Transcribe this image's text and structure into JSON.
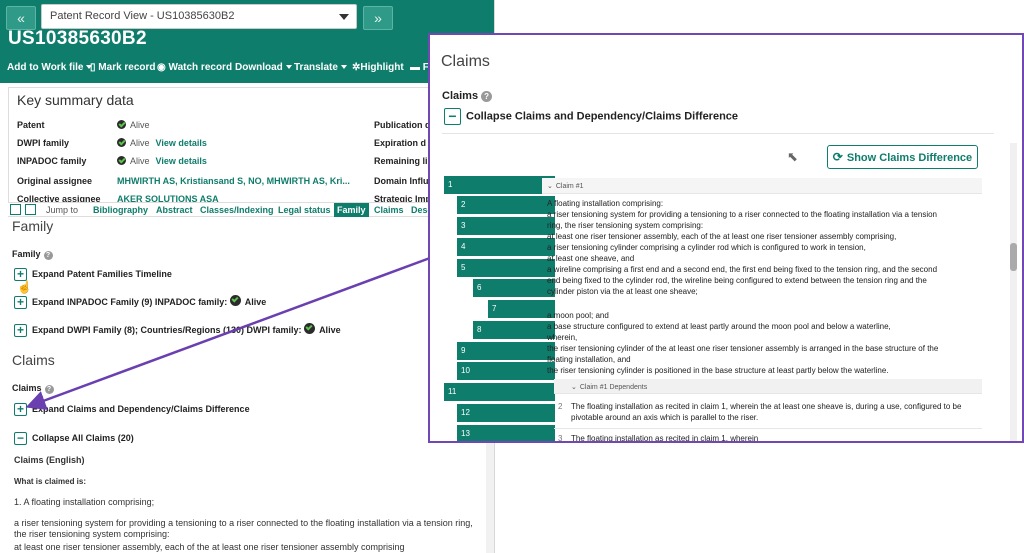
{
  "header": {
    "back_icon": "«",
    "forward_icon": "»",
    "view_select": "Patent Record View - US10385630B2",
    "record_number": "US10385630B2"
  },
  "toolbar": {
    "add_to_work_file": "Add to Work file",
    "mark_record": "Mark record",
    "watch_record": "Watch record",
    "download": "Download",
    "translate": "Translate",
    "highlight": "Highlight",
    "print_icon": "print-icon",
    "bookmark_icon": "bookmark-icon",
    "eye_icon": "eye-icon",
    "gear_icon": "gear-icon",
    "print_label_fragment": "F"
  },
  "summary": {
    "title": "Key summary data",
    "rows": [
      {
        "label": "Patent",
        "value": "Alive",
        "link": "",
        "right": "Publication d"
      },
      {
        "label": "DWPI family",
        "value": "Alive",
        "link": "View details",
        "right": "Expiration d"
      },
      {
        "label": "INPADOC family",
        "value": "Alive",
        "link": "View details",
        "right": "Remaining li"
      },
      {
        "label": "Original assignee",
        "value": "MHWIRTH AS, Kristiansand S, NO, MHWIRTH AS, Kri...",
        "link": "",
        "right": "Domain Influ"
      },
      {
        "label": "Collective assignee",
        "value": "AKER SOLUTIONS ASA",
        "link": "",
        "right": "Strategic Imp"
      }
    ]
  },
  "jumpbar": {
    "pdf_icon": "pdf-icon",
    "external_link_icon": "external-link-icon",
    "jump_to": "Jump to",
    "links": [
      "Bibliography",
      "Abstract",
      "Classes/Indexing",
      "Legal status",
      "Family",
      "Claims",
      "Desc"
    ],
    "active": "Family"
  },
  "family": {
    "heading": "Family",
    "sub": "Family",
    "expand_timeline": "Expand Patent Families Timeline",
    "expand_inpadoc": "Expand INPADOC Family (9) INPADOC family:",
    "inpadoc_status": "Alive",
    "expand_dwpi": "Expand DWPI Family (8); Countries/Regions (130) DWPI family:",
    "dwpi_status": "Alive"
  },
  "claims": {
    "heading": "Claims",
    "sub": "Claims",
    "expand_claims_dependency": "Expand Claims and Dependency/Claims Difference",
    "collapse_all": "Collapse All Claims (20)",
    "english_label": "Claims (English)",
    "what_is_claimed": "What is claimed is:",
    "claim1_intro": "1. A floating installation comprising;",
    "claim1_text": "a riser tensioning system for providing a tensioning to a riser connected to the floating installation via a tension ring, the riser tensioning system comprising:",
    "claim1_cut": "at least one riser tensioner assembly, each of the at least one riser tensioner assembly comprising"
  },
  "popup": {
    "title": "Claims",
    "claims_label": "Claims",
    "collapse_label": "Collapse Claims and Dependency/Claims Difference",
    "show_diff": "Show Claims Difference",
    "claim_numbers": [
      "1",
      "2",
      "3",
      "4",
      "5",
      "6",
      "7",
      "8",
      "9",
      "10",
      "11",
      "12",
      "13"
    ],
    "claim1_head": "Claim #1",
    "claim1_lines": [
      "A floating installation comprising:",
      "a riser tensioning system for providing a tensioning to a riser connected to the floating installation via a tension",
      "ring, the riser tensioning system comprising:",
      "at least one riser tensioner assembly, each of the at least one riser tensioner assembly comprising,",
      "a riser tensioning cylinder comprising a cylinder rod which is configured to work in tension,",
      "at least one sheave, and",
      "a wireline comprising a first end and a second end, the first end being fixed to the tension ring, and the second",
      "end being fixed to the cylinder rod, the wireline being configured to extend between the tension ring and the",
      "cylinder piston via the at least one sheave;",
      "",
      "a moon pool; and",
      "a base structure configured to extend at least partly around the moon pool and below a waterline,",
      "wherein,",
      "the riser tensioning cylinder of the at least one riser tensioner assembly is arranged in the base structure of the",
      "floating installation, and",
      "the riser tensioning cylinder is positioned in the base structure at least partly below the waterline."
    ],
    "dependents_head": "Claim #1 Dependents",
    "dependents": [
      {
        "num": "2",
        "text": "The floating installation as recited in claim 1, wherein the at least one sheave is, during a use, configured to be pivotable around an axis which is parallel to the riser."
      },
      {
        "num": "3",
        "text": "The floating installation as recited in claim 1, wherein"
      }
    ]
  },
  "colors": {
    "teal": "#0f7d6b",
    "purple_outline": "#7048b6"
  }
}
